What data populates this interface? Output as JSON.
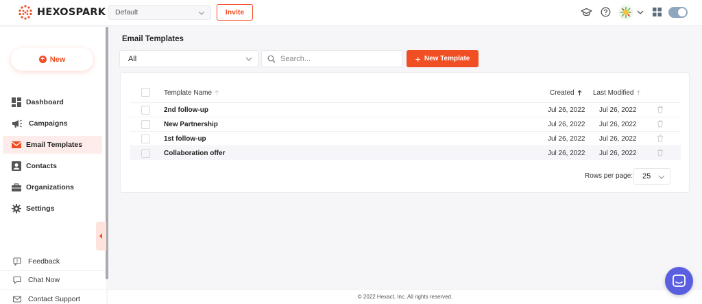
{
  "brand": {
    "name": "HEXOSPARK"
  },
  "topbar": {
    "workspace_value": "Default",
    "invite_label": "Invite",
    "icons": [
      "graduation-cap-icon",
      "help-icon",
      "avatar",
      "chevron-down-icon",
      "apps-grid-icon",
      "theme-toggle"
    ]
  },
  "sidebar": {
    "new_label": "New",
    "items": [
      {
        "label": "Dashboard",
        "icon": "dashboard-icon",
        "active": false
      },
      {
        "label": "Campaigns",
        "icon": "megaphone-icon",
        "active": false
      },
      {
        "label": "Email Templates",
        "icon": "envelope-icon",
        "active": true
      },
      {
        "label": "Contacts",
        "icon": "contact-icon",
        "active": false
      },
      {
        "label": "Organizations",
        "icon": "briefcase-icon",
        "active": false
      },
      {
        "label": "Settings",
        "icon": "gear-icon",
        "active": false
      }
    ],
    "footer_items": [
      {
        "label": "Feedback",
        "icon": "feedback-icon"
      },
      {
        "label": "Chat Now",
        "icon": "chat-icon"
      },
      {
        "label": "Contact Support",
        "icon": "mail-icon"
      }
    ]
  },
  "main": {
    "title": "Email Templates",
    "filter_value": "All",
    "search_placeholder": "Search...",
    "new_template_label": "New Template",
    "table": {
      "columns": {
        "name": "Template Name",
        "created": "Created",
        "modified": "Last Modified"
      },
      "rows": [
        {
          "name": "2nd follow-up",
          "created": "Jul 26, 2022",
          "modified": "Jul 26, 2022"
        },
        {
          "name": "New Partnership",
          "created": "Jul 26, 2022",
          "modified": "Jul 26, 2022"
        },
        {
          "name": "1st follow-up",
          "created": "Jul 26, 2022",
          "modified": "Jul 26, 2022"
        },
        {
          "name": "Collaboration offer",
          "created": "Jul 26, 2022",
          "modified": "Jul 26, 2022"
        }
      ]
    },
    "pagination": {
      "rows_per_page_label": "Rows per page:",
      "rows_per_page_value": "25"
    }
  },
  "footer": {
    "copyright": "© 2022 Hexact, Inc. All rights reserved."
  },
  "colors": {
    "accent": "#f04e23",
    "chat": "#5a5fe0",
    "active_bg": "#fdecea"
  }
}
